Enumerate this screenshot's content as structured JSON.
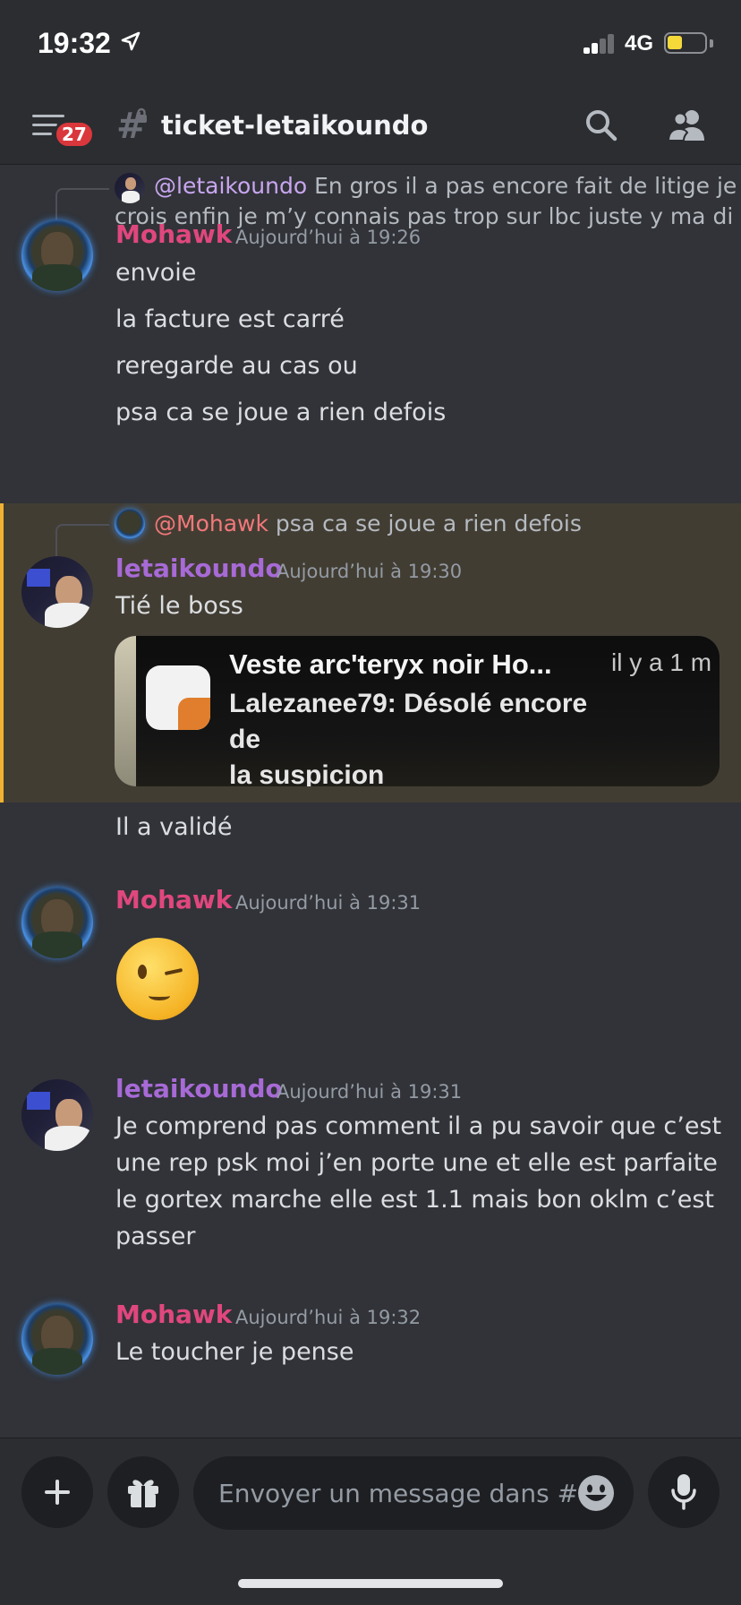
{
  "status_bar": {
    "time": "19:32",
    "network": "4G",
    "battery_color": "#f5d83a",
    "battery_level": 0.42,
    "signal_bars_active": 2,
    "signal_bars_total": 4
  },
  "header": {
    "badge_count": "27",
    "channel_name": "ticket-letaikoundo",
    "icons": [
      "menu-icon",
      "hash-lock-icon",
      "search-icon",
      "members-icon"
    ]
  },
  "messages": {
    "reply1": {
      "mention": "@letaikoundo",
      "text_line1": "En gros il a pas encore fait de litige je",
      "text_line2": "crois enfin je m’y connais pas trop sur lbc juste y ma di..."
    },
    "group1": {
      "username": "Mohawk",
      "timestamp": "Aujourd’hui à 19:26",
      "lines": [
        "envoie",
        "la facture est carré",
        "reregarde au cas ou",
        "psa ca se joue a rien defois"
      ]
    },
    "reply2": {
      "mention": "@Mohawk",
      "text": "psa ca se joue a rien defois"
    },
    "group2": {
      "username": "letaikoundo",
      "timestamp": "Aujourd’hui à 19:30",
      "lines": [
        "Tié le boss"
      ],
      "attachment": {
        "title": "Veste arc'teryx noir Ho...",
        "time": "il y a 1 m",
        "body_line1": "Lalezanee79: Désolé encore de",
        "body_line2": "la suspicion"
      },
      "after_line": "Il a validé"
    },
    "group3": {
      "username": "Mohawk",
      "timestamp": "Aujourd’hui à 19:31",
      "emoji": "winking-face"
    },
    "group4": {
      "username": "letaikoundo",
      "timestamp": "Aujourd’hui à 19:31",
      "lines": [
        "Je comprend pas comment il a pu savoir que c’est",
        "une rep psk moi j’en porte une et elle est parfaite",
        "le gortex marche elle est 1.1 mais bon oklm c’est",
        "passer"
      ]
    },
    "group5": {
      "username": "Mohawk",
      "timestamp": "Aujourd’hui à 19:32",
      "lines": [
        "Le toucher je pense"
      ]
    }
  },
  "composer": {
    "placeholder": "Envoyer un message dans #..",
    "icons": [
      "plus-icon",
      "gift-icon",
      "emoji-icon",
      "microphone-icon"
    ]
  },
  "colors": {
    "background": "#313338",
    "header": "#2b2d31",
    "mohawk": "#e0477d",
    "letaikoundo": "#a76ad6",
    "highlight": "#423d33",
    "highlight_bar": "#f0b232",
    "badge": "#da373c"
  }
}
